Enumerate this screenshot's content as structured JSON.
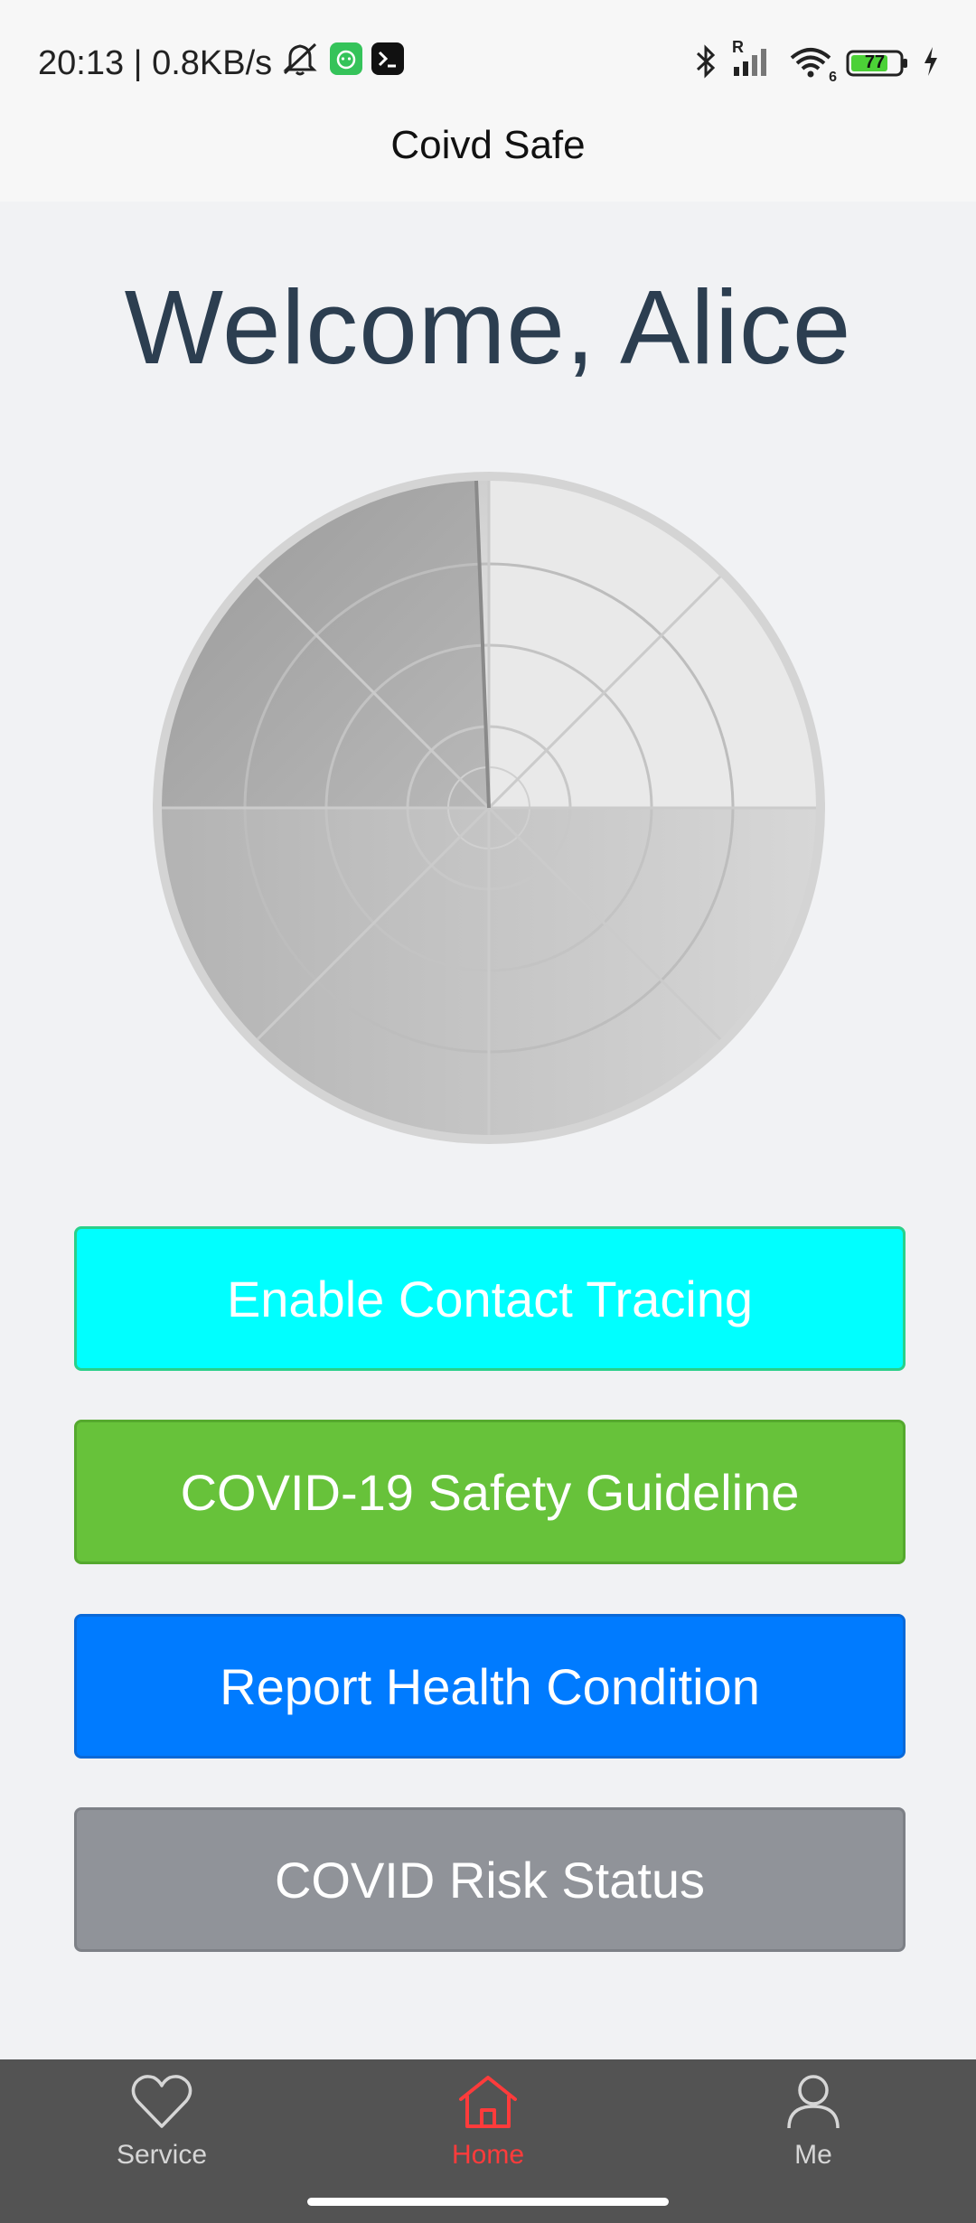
{
  "status_bar": {
    "time_and_speed": "20:13 | 0.8KB/s",
    "battery_level": "77",
    "signal_label": "R",
    "wifi_label": "6",
    "icons": [
      "mute-icon",
      "cat-app-icon",
      "terminal-app-icon",
      "bluetooth-icon",
      "signal-icon",
      "wifi-icon",
      "battery-icon",
      "charging-icon"
    ]
  },
  "app_bar": {
    "title": "Coivd Safe"
  },
  "main": {
    "welcome": "Welcome, Alice",
    "radar_icon": "radar-icon"
  },
  "buttons": {
    "enable_tracing": "Enable Contact Tracing",
    "safety_guideline": "COVID-19 Safety Guideline",
    "report_health": "Report Health Condition",
    "risk_status": "COVID Risk Status"
  },
  "tab_bar": {
    "items": [
      {
        "label": "Service",
        "icon": "heart-icon"
      },
      {
        "label": "Home",
        "icon": "home-icon"
      },
      {
        "label": "Me",
        "icon": "user-icon"
      }
    ],
    "active": "Home"
  },
  "colors": {
    "enable_tracing": "#00ffff",
    "safety_guideline": "#67c23a",
    "report_health": "#007bff",
    "risk_status": "#909399",
    "tab_active": "#ff3b3b",
    "tab_bar_bg": "#535353",
    "welcome_text": "#2c3e50"
  }
}
